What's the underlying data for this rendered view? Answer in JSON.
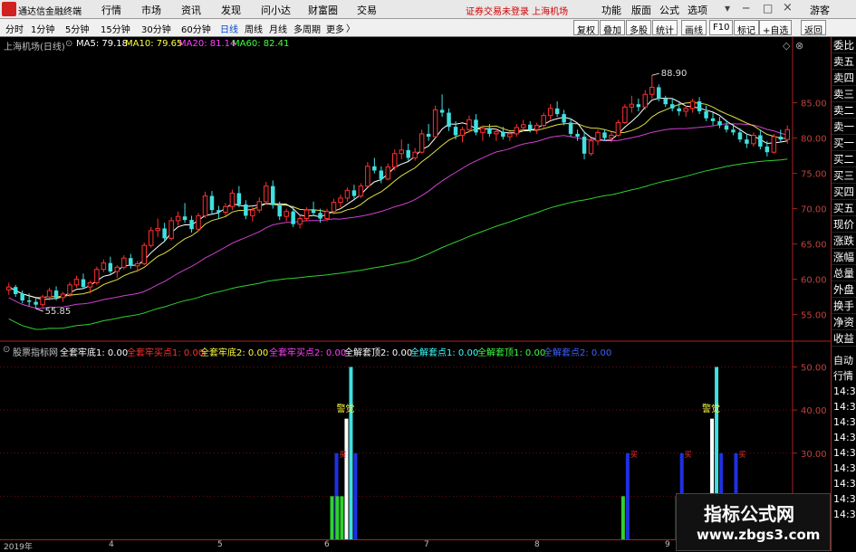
{
  "app": {
    "title": "通达信金融终端",
    "menu": [
      "行情",
      "市场",
      "资讯",
      "发现",
      "问小达",
      "财富圈",
      "交易"
    ],
    "status": "证券交易未登录  上海机场",
    "right_menu": [
      "功能",
      "版面",
      "公式",
      "选项"
    ],
    "guest": "游客"
  },
  "toolbar": {
    "timeframes": [
      "分时",
      "1分钟",
      "5分钟",
      "15分钟",
      "30分钟",
      "60分钟",
      "日线",
      "周线",
      "月线",
      "多周期",
      "更多"
    ],
    "active": "日线",
    "right_buttons": [
      "复权",
      "叠加",
      "多股",
      "统计",
      "画线",
      "F10",
      "标记",
      "+自选",
      "返回"
    ]
  },
  "main_legend": {
    "stock": "上海机场(日线)",
    "ma5": "MA5: 79.18",
    "ma10": "MA10: 79.65",
    "ma20": "MA20: 81.14",
    "ma60": "MA60: 82.41"
  },
  "sub_legend": {
    "title": "股票指标网",
    "items": [
      {
        "text": "全套牢底1: 0.00",
        "color": "#ffffff"
      },
      {
        "text": "全套牢买点1: 0.00",
        "color": "#ff3030"
      },
      {
        "text": "全套牢底2: 0.00",
        "color": "#ffff40"
      },
      {
        "text": "全套牢买点2: 0.00",
        "color": "#ff40ff"
      },
      {
        "text": "全解套顶2: 0.00",
        "color": "#ffffff"
      },
      {
        "text": "全解套点1: 0.00",
        "color": "#40ffff"
      },
      {
        "text": "全解套顶1: 0.00",
        "color": "#40ff40"
      },
      {
        "text": "全解套点2: 0.00",
        "color": "#4060ff"
      }
    ]
  },
  "main_yaxis": [
    "85.00",
    "80.00",
    "75.00",
    "70.00",
    "65.00",
    "60.00",
    "55.00"
  ],
  "sub_yaxis": [
    "50.00",
    "40.00",
    "30.00",
    "20.00"
  ],
  "annotations": {
    "high": "88.90",
    "low": "55.85",
    "signal_labels": [
      "警觉",
      "警觉"
    ],
    "buy_labels": [
      "买",
      "买",
      "买",
      "买",
      "买"
    ]
  },
  "dates": [
    "2019年",
    "4",
    "5",
    "6",
    "7",
    "8",
    "9"
  ],
  "right_panel_upper": [
    "委比",
    "卖五",
    "卖四",
    "卖三",
    "卖二",
    "卖一",
    "买一",
    "买二",
    "买三",
    "买四",
    "买五",
    "现价",
    "涨跌",
    "涨幅",
    "总量",
    "外盘",
    "换手",
    "净资",
    "收益"
  ],
  "right_panel_lower": [
    "自动",
    "行情",
    "14:3",
    "14:3",
    "14:3",
    "14:3",
    "14:3",
    "14:3",
    "14:3",
    "14:3",
    "14:3"
  ],
  "watermark": {
    "line1": "指标公式网",
    "line2": "www.zbgs3.com"
  },
  "chart_data": {
    "type": "candlestick",
    "yrange": [
      52,
      92
    ],
    "candles": [
      [
        58.5,
        59.5,
        57.8,
        58.9
      ],
      [
        58.9,
        59.2,
        57.5,
        57.9
      ],
      [
        57.9,
        58.4,
        56.6,
        57.0
      ],
      [
        57.0,
        58.0,
        56.2,
        56.8
      ],
      [
        56.8,
        57.3,
        55.85,
        56.4
      ],
      [
        56.4,
        57.8,
        56.0,
        57.5
      ],
      [
        57.5,
        58.8,
        57.0,
        58.4
      ],
      [
        58.4,
        59.0,
        57.0,
        57.4
      ],
      [
        57.4,
        58.2,
        56.8,
        57.9
      ],
      [
        57.9,
        59.6,
        57.5,
        59.2
      ],
      [
        59.2,
        60.5,
        58.8,
        60.0
      ],
      [
        60.0,
        60.8,
        58.6,
        58.9
      ],
      [
        58.9,
        59.8,
        58.0,
        59.5
      ],
      [
        59.5,
        61.8,
        59.2,
        61.4
      ],
      [
        61.4,
        62.8,
        61.0,
        62.3
      ],
      [
        62.3,
        63.2,
        60.8,
        61.1
      ],
      [
        61.1,
        62.0,
        60.2,
        61.7
      ],
      [
        61.7,
        63.4,
        61.4,
        63.0
      ],
      [
        63.0,
        63.6,
        61.5,
        61.9
      ],
      [
        61.9,
        62.6,
        61.0,
        62.2
      ],
      [
        62.2,
        65.2,
        62.0,
        64.8
      ],
      [
        64.8,
        67.4,
        64.5,
        66.9
      ],
      [
        66.9,
        68.6,
        66.0,
        67.2
      ],
      [
        67.2,
        68.0,
        65.4,
        65.8
      ],
      [
        65.8,
        68.8,
        65.5,
        68.3
      ],
      [
        68.3,
        69.6,
        67.6,
        68.9
      ],
      [
        68.9,
        70.8,
        68.0,
        68.4
      ],
      [
        68.4,
        69.0,
        66.6,
        67.1
      ],
      [
        67.1,
        69.4,
        66.8,
        69.0
      ],
      [
        69.0,
        72.4,
        68.7,
        71.8
      ],
      [
        71.8,
        72.5,
        69.2,
        69.8
      ],
      [
        69.8,
        70.4,
        68.6,
        69.5
      ],
      [
        69.5,
        70.8,
        69.0,
        70.3
      ],
      [
        70.3,
        72.7,
        69.8,
        72.2
      ],
      [
        72.2,
        73.2,
        70.2,
        70.6
      ],
      [
        70.6,
        71.2,
        68.5,
        69.0
      ],
      [
        69.0,
        70.2,
        68.2,
        69.8
      ],
      [
        69.8,
        71.6,
        69.4,
        71.0
      ],
      [
        71.0,
        73.8,
        70.6,
        73.2
      ],
      [
        73.2,
        74.0,
        70.0,
        70.5
      ],
      [
        70.5,
        71.0,
        68.4,
        68.9
      ],
      [
        68.9,
        70.0,
        68.2,
        69.6
      ],
      [
        69.6,
        70.4,
        67.4,
        67.8
      ],
      [
        67.8,
        69.0,
        67.2,
        68.6
      ],
      [
        68.6,
        70.2,
        68.2,
        69.8
      ],
      [
        69.8,
        71.0,
        69.0,
        69.4
      ],
      [
        69.4,
        70.0,
        68.0,
        68.6
      ],
      [
        68.6,
        70.0,
        68.2,
        69.6
      ],
      [
        69.6,
        71.4,
        69.2,
        70.9
      ],
      [
        70.9,
        72.0,
        70.2,
        71.5
      ],
      [
        71.5,
        73.0,
        71.0,
        72.6
      ],
      [
        72.6,
        73.4,
        71.4,
        71.8
      ],
      [
        71.8,
        73.6,
        71.5,
        73.2
      ],
      [
        73.2,
        76.6,
        73.0,
        76.0
      ],
      [
        76.0,
        77.2,
        75.0,
        75.4
      ],
      [
        75.4,
        76.0,
        73.6,
        74.2
      ],
      [
        74.2,
        76.4,
        74.0,
        75.9
      ],
      [
        75.9,
        78.4,
        75.4,
        77.8
      ],
      [
        77.8,
        79.8,
        77.0,
        78.3
      ],
      [
        78.3,
        79.2,
        76.8,
        77.2
      ],
      [
        77.2,
        78.6,
        76.8,
        78.0
      ],
      [
        78.0,
        81.2,
        77.8,
        80.6
      ],
      [
        80.6,
        82.0,
        79.6,
        80.2
      ],
      [
        80.2,
        84.6,
        80.0,
        84.0
      ],
      [
        84.0,
        86.2,
        83.0,
        83.6
      ],
      [
        83.6,
        84.2,
        81.0,
        81.6
      ],
      [
        81.6,
        82.4,
        79.8,
        80.4
      ],
      [
        80.4,
        81.6,
        79.4,
        81.2
      ],
      [
        81.2,
        83.2,
        80.8,
        82.6
      ],
      [
        82.6,
        83.4,
        80.4,
        80.8
      ],
      [
        80.8,
        81.8,
        79.6,
        81.4
      ],
      [
        81.4,
        82.0,
        80.2,
        80.6
      ],
      [
        80.6,
        81.4,
        79.6,
        80.9
      ],
      [
        80.9,
        81.6,
        79.8,
        80.2
      ],
      [
        80.2,
        81.0,
        79.6,
        80.6
      ],
      [
        80.6,
        82.0,
        80.2,
        81.5
      ],
      [
        81.5,
        82.6,
        81.0,
        81.9
      ],
      [
        81.9,
        82.4,
        80.8,
        81.2
      ],
      [
        81.2,
        82.2,
        80.6,
        81.8
      ],
      [
        81.8,
        83.6,
        81.4,
        83.2
      ],
      [
        83.2,
        84.8,
        82.6,
        84.2
      ],
      [
        84.2,
        85.2,
        83.0,
        83.4
      ],
      [
        83.4,
        84.0,
        81.8,
        82.2
      ],
      [
        82.2,
        82.8,
        80.2,
        80.6
      ],
      [
        80.6,
        81.2,
        79.6,
        80.2
      ],
      [
        80.2,
        81.0,
        77.0,
        77.8
      ],
      [
        77.8,
        80.0,
        77.5,
        79.6
      ],
      [
        79.6,
        81.2,
        79.0,
        80.8
      ],
      [
        80.8,
        81.2,
        79.6,
        80.0
      ],
      [
        80.0,
        80.8,
        79.4,
        80.4
      ],
      [
        80.4,
        82.6,
        80.2,
        82.2
      ],
      [
        82.2,
        84.8,
        82.0,
        84.4
      ],
      [
        84.4,
        86.0,
        83.6,
        84.8
      ],
      [
        84.8,
        85.6,
        83.8,
        84.4
      ],
      [
        84.4,
        86.8,
        84.0,
        86.2
      ],
      [
        86.2,
        88.9,
        85.6,
        87.2
      ],
      [
        87.2,
        87.6,
        85.2,
        85.6
      ],
      [
        85.6,
        86.0,
        84.4,
        84.8
      ],
      [
        84.8,
        85.6,
        83.8,
        84.2
      ],
      [
        84.2,
        85.0,
        83.2,
        83.8
      ],
      [
        83.8,
        84.6,
        83.0,
        84.2
      ],
      [
        84.2,
        85.6,
        83.6,
        85.2
      ],
      [
        85.2,
        85.8,
        83.4,
        83.8
      ],
      [
        83.8,
        84.6,
        82.4,
        82.8
      ],
      [
        82.8,
        83.6,
        81.8,
        82.4
      ],
      [
        82.4,
        83.0,
        81.4,
        81.8
      ],
      [
        81.8,
        82.6,
        80.8,
        81.2
      ],
      [
        81.2,
        82.0,
        80.4,
        80.8
      ],
      [
        80.8,
        81.4,
        79.4,
        79.8
      ],
      [
        79.8,
        80.6,
        78.6,
        79.2
      ],
      [
        79.2,
        80.8,
        78.8,
        80.4
      ],
      [
        80.4,
        81.2,
        78.4,
        78.8
      ],
      [
        78.8,
        79.6,
        77.4,
        78.0
      ],
      [
        78.0,
        80.6,
        77.8,
        80.2
      ],
      [
        80.2,
        81.2,
        79.4,
        79.8
      ],
      [
        79.8,
        81.8,
        79.2,
        81.2
      ]
    ],
    "signals": [
      {
        "idx": 48,
        "kind": "buy"
      },
      {
        "idx": 50,
        "kind": "alert"
      },
      {
        "idx": 91,
        "kind": "buy"
      },
      {
        "idx": 99,
        "kind": "buy"
      },
      {
        "idx": 104,
        "kind": "alert"
      },
      {
        "idx": 107,
        "kind": "buy"
      },
      {
        "idx": 159,
        "kind": "buy"
      }
    ]
  }
}
